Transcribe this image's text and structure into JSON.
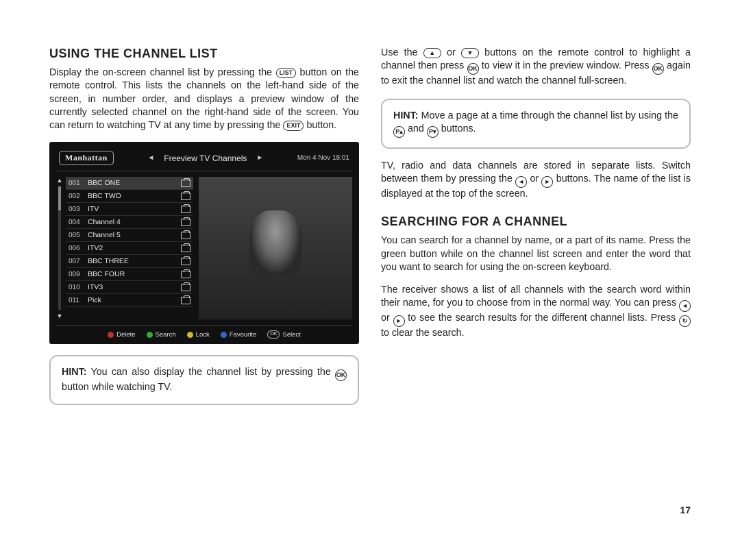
{
  "page_number": "17",
  "headings": {
    "using_channel_list": "USING THE CHANNEL LIST",
    "searching_for_channel": "SEARCHING FOR A CHANNEL"
  },
  "paragraphs": {
    "p1a": "Display the on-screen channel list by pressing the ",
    "p1b": " button on the remote control. This lists the channels on the left-hand side of the screen, in number order, and displays a preview window of the currently selected channel on the right-hand side of the screen. You can return to watching TV at any time by pressing the ",
    "p1c": " button.",
    "hint1a": "HINT:",
    "hint1b": " You can also display the channel list by pressing the ",
    "hint1c": " button while watching TV.",
    "p2a": "Use the ",
    "p2b": " or ",
    "p2c": " buttons on the remote control to highlight a channel then press ",
    "p2d": " to view it in the preview window. Press ",
    "p2e": " again to exit the channel list and watch the channel full-screen.",
    "hint2a": "HINT:",
    "hint2b": " Move a page at a time through the channel list by using the ",
    "hint2c": " and ",
    "hint2d": " buttons.",
    "p3a": "TV, radio and data channels are stored in separate lists. Switch between them by pressing the ",
    "p3b": " or ",
    "p3c": " buttons. The name of the list is displayed at the top of the screen.",
    "p4": "You can search for a channel by name, or a part of its name. Press the green button while on the channel list screen and enter the word that you want to search for using the on-screen keyboard.",
    "p5a": "The receiver shows a list of all channels with the search word within their name, for you to choose from in the normal way. You can press ",
    "p5b": " or ",
    "p5c": " to see the search results for the different channel lists. Press ",
    "p5d": " to clear the search."
  },
  "buttons": {
    "list": "LIST",
    "exit": "EXIT",
    "ok": "OK",
    "up": "▲",
    "down": "▼",
    "left": "◄",
    "right": "►",
    "pplus": "P▴",
    "pminus": "P▾",
    "clear": "↻"
  },
  "tv": {
    "logo": "Manhattan",
    "title": "Freeview TV Channels",
    "time": "Mon 4 Nov 18:01",
    "footer": {
      "delete": "Delete",
      "search": "Search",
      "lock": "Lock",
      "favourite": "Favourite",
      "select": "Select",
      "ok": "OK"
    },
    "channels": [
      {
        "num": "001",
        "name": "BBC ONE"
      },
      {
        "num": "002",
        "name": "BBC TWO"
      },
      {
        "num": "003",
        "name": "ITV"
      },
      {
        "num": "004",
        "name": "Channel 4"
      },
      {
        "num": "005",
        "name": "Channel 5"
      },
      {
        "num": "006",
        "name": "ITV2"
      },
      {
        "num": "007",
        "name": "BBC THREE"
      },
      {
        "num": "009",
        "name": "BBC FOUR"
      },
      {
        "num": "010",
        "name": "ITV3"
      },
      {
        "num": "011",
        "name": "Pick"
      }
    ]
  }
}
